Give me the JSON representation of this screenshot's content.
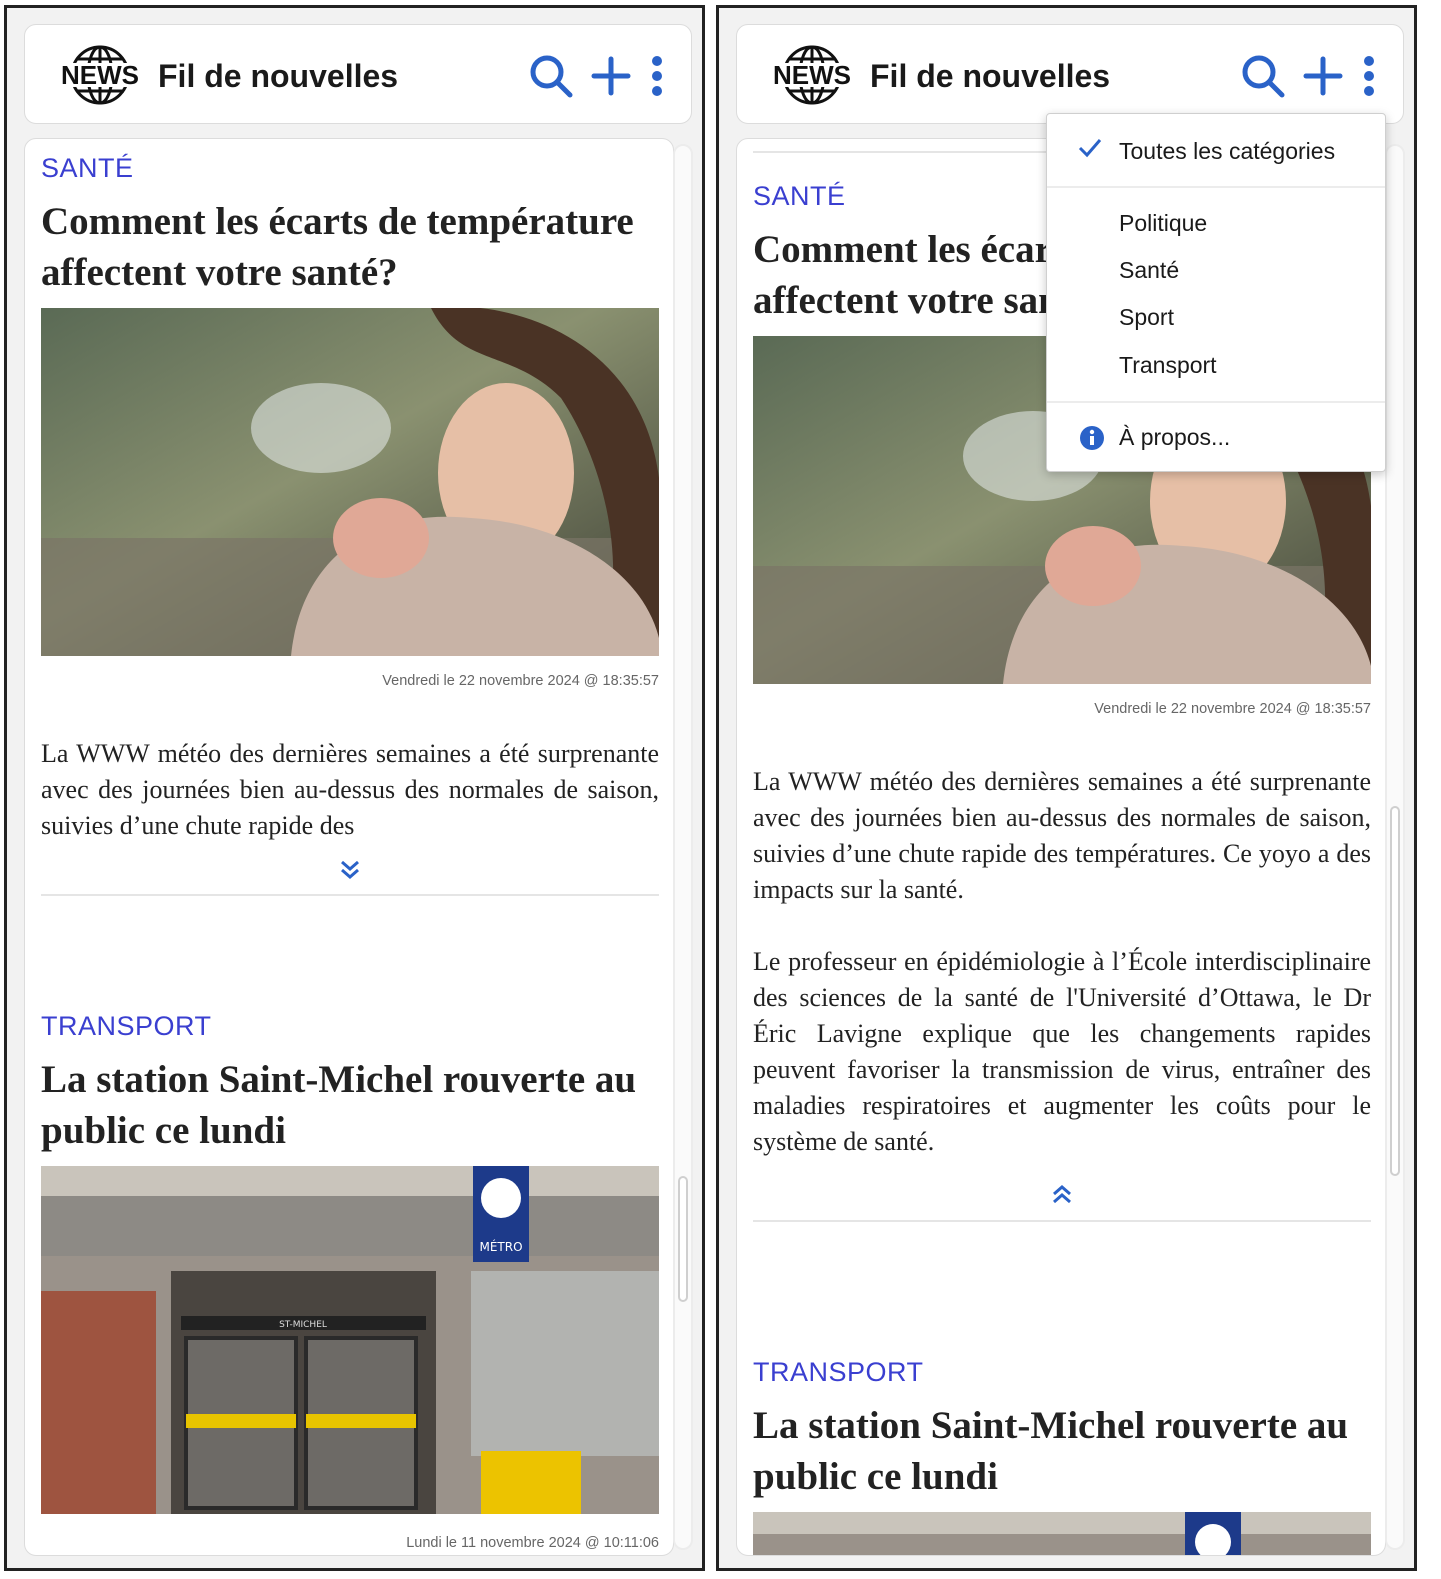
{
  "app": {
    "logo_text": "NEWS",
    "title": "Fil de nouvelles"
  },
  "header_icons": [
    "search-icon",
    "plus-icon",
    "kebab-menu-icon"
  ],
  "colors": {
    "accent": "#2a62c8",
    "category": "#3a3fd0",
    "text": "#222222"
  },
  "left": {
    "article1": {
      "category": "SANTÉ",
      "title": "Comment les écarts de température affectent votre santé?",
      "date": "Vendredi le 22 novembre 2024 @ 18:35:57",
      "excerpt": "La WWW météo des dernières semaines a été surprenante avec des journées bien au-dessus des normales de saison, suivies d’une chute rapide des"
    },
    "article2": {
      "category": "TRANSPORT",
      "title": "La station Saint-Michel rouverte au public ce lundi",
      "photo_sign": "ST-MICHEL",
      "photo_logo": "MÉTRO",
      "date": "Lundi le 11 novembre 2024 @ 10:11:06"
    }
  },
  "right": {
    "article1": {
      "category": "SANTÉ",
      "title": "Comment les écarts de température affectent votre santé?",
      "date": "Vendredi le 22 novembre 2024 @ 18:35:57",
      "para1": "La WWW météo des dernières semaines a été surprenante avec des journées bien au-dessus des normales de saison, suivies d’une chute rapide des températures. Ce yoyo a des impacts sur la santé.",
      "para2": "Le professeur en épidémiologie à l’École interdisciplinaire des sciences de la santé de l'Université d’Ottawa, le Dr Éric Lavigne explique que les changements rapides peuvent favoriser la transmission de virus, entraîner des maladies respiratoires et augmenter les coûts pour le système de santé."
    },
    "article2": {
      "category": "TRANSPORT",
      "title": "La station Saint-Michel rouverte au public ce lundi"
    }
  },
  "menu": {
    "all_categories": "Toutes les catégories",
    "all_checked": true,
    "categories": [
      "Politique",
      "Santé",
      "Sport",
      "Transport"
    ],
    "about": "À propos..."
  }
}
